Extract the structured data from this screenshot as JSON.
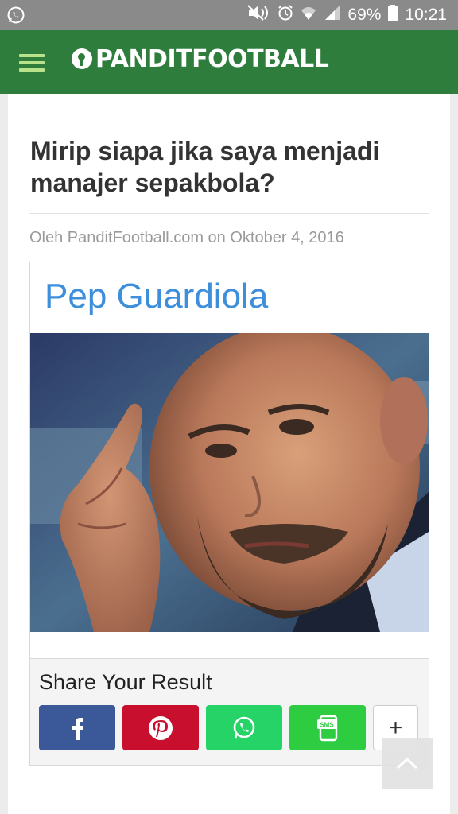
{
  "status_bar": {
    "battery": "69%",
    "time": "10:21"
  },
  "app_bar": {
    "logo_text": "PANDITFOOTBALL"
  },
  "article": {
    "title": "Mirip siapa jika saya menjadi manajer sepakbola?",
    "meta": "Oleh PanditFootball.com on Oktober 4, 2016"
  },
  "result": {
    "name": "Pep Guardiola"
  },
  "share": {
    "title": "Share Your Result",
    "buttons": [
      {
        "icon": "facebook-icon",
        "color": "#3b5998"
      },
      {
        "icon": "pinterest-icon",
        "color": "#c8102e"
      },
      {
        "icon": "whatsapp-icon",
        "color": "#25d366"
      },
      {
        "icon": "sms-icon",
        "color": "#2ecc40"
      },
      {
        "icon": "plus-icon",
        "label": "+"
      }
    ]
  },
  "colors": {
    "status_bar": "#8a8a8a",
    "app_bar": "#2e7d3c",
    "result_name": "#3d8fdc"
  }
}
